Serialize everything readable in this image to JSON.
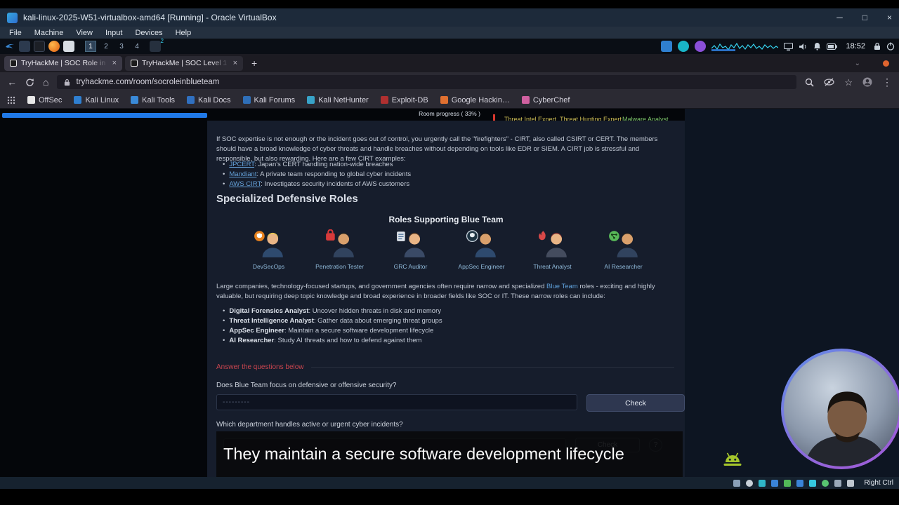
{
  "window": {
    "title": "kali-linux-2025-W51-virtualbox-amd64 [Running] - Oracle VirtualBox",
    "menu": [
      "File",
      "Machine",
      "View",
      "Input",
      "Devices",
      "Help"
    ],
    "controls": {
      "minimize": "─",
      "maximize": "□",
      "close": "×"
    },
    "host_key": "Right Ctrl"
  },
  "panel": {
    "workspaces": [
      "1",
      "2",
      "3",
      "4"
    ],
    "window_badge": "2",
    "clock": "18:52"
  },
  "browser": {
    "tabs": [
      {
        "title": "TryHackMe | SOC Role in"
      },
      {
        "title": "TryHackMe | SOC Level 1"
      }
    ],
    "new_tab": "+",
    "url": "tryhackme.com/room/socroleinblueteam",
    "bookmarks": [
      {
        "label": "OffSec"
      },
      {
        "label": "Kali Linux"
      },
      {
        "label": "Kali Tools"
      },
      {
        "label": "Kali Docs"
      },
      {
        "label": "Kali Forums"
      },
      {
        "label": "Kali NetHunter"
      },
      {
        "label": "Exploit-DB"
      },
      {
        "label": "Google Hackin…"
      },
      {
        "label": "CyberChef"
      }
    ]
  },
  "page": {
    "progress_label": "Room progress ( 33% )",
    "top_tabs": [
      "Threat Intel Expert",
      "Threat Hunting Expert",
      "Malware Analyst"
    ],
    "intro": "If SOC expertise is not enough or the incident goes out of control, you urgently call the \"firefighters\" - CIRT, also called CSIRT or CERT. The members should have a broad knowledge of cyber threats and handle breaches without depending on tools like EDR or SIEM. A CIRT job is stressful and responsible, but also rewarding. Here are a few CIRT examples:",
    "cirt_examples": [
      {
        "term": "JPCERT",
        "desc": ": Japan's CERT handling nation-wide breaches"
      },
      {
        "term": "Mandiant",
        "desc": ": A private team responding to global cyber incidents"
      },
      {
        "term": "AWS CIRT",
        "desc": ": Investigates security incidents of AWS customers"
      }
    ],
    "section_heading": "Specialized Defensive Roles",
    "roles_title": "Roles Supporting Blue Team",
    "roles": [
      "DevSecOps",
      "Penetration Tester",
      "GRC Auditor",
      "AppSec Engineer",
      "Threat Analyst",
      "AI Researcher"
    ],
    "paragraph2": {
      "p1": "Large companies, technology-focused startups, and government agencies often require narrow and specialized ",
      "link": "Blue Team",
      "p2": " roles - exciting and highly valuable, but requiring deep topic knowledge and broad experience in broader fields like SOC or IT. These narrow roles can include:"
    },
    "narrow_roles": [
      {
        "term": "Digital Forensics Analyst",
        "desc": ": Uncover hidden threats in disk and memory"
      },
      {
        "term": "Threat Intelligence Analyst",
        "desc": ": Gather data about emerging threat groups"
      },
      {
        "term": "AppSec Engineer",
        "desc": ": Maintain a secure software development lifecycle"
      },
      {
        "term": "AI Researcher",
        "desc": ": Study AI threats and how to defend against them"
      }
    ],
    "answer_heading": "Answer the questions below",
    "questions": [
      {
        "text": "Does Blue Team focus on defensive or offensive security?",
        "placeholder": "---------"
      },
      {
        "text": "Which department handles active or urgent cyber incidents?"
      }
    ],
    "check_label": "Check",
    "hint_label": "?"
  },
  "caption": {
    "text": "They maintain a secure software development lifecycle"
  },
  "colors": {
    "progress_blue": "#2079e8",
    "answer_red": "#c9454f",
    "link_blue": "#5e9fd9",
    "role_label_blue": "#8fb9d9",
    "toptab_yellow": "#cdbd55",
    "toptab_green": "#7cc46a",
    "caption_bg": "#080808"
  }
}
